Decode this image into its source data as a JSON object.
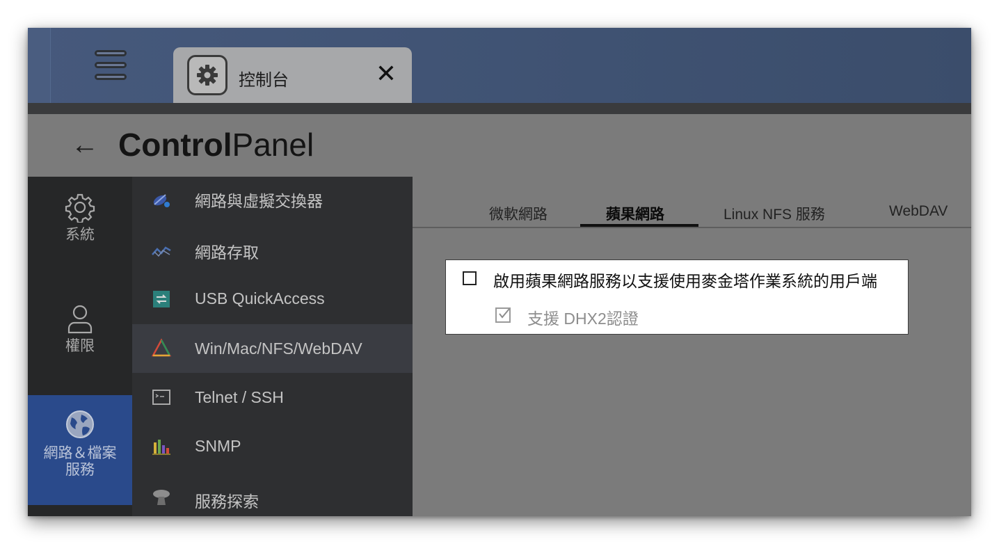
{
  "window": {
    "tab_title": "控制台",
    "tab_close": "✕"
  },
  "header": {
    "back": "←",
    "title_bold": "Control",
    "title_light": "Panel"
  },
  "rail": {
    "items": [
      {
        "label": "系統",
        "icon": "gear-outline-icon"
      },
      {
        "label": "權限",
        "icon": "user-outline-icon"
      },
      {
        "label_line1": "網路＆檔案",
        "label_line2": "服務",
        "icon": "globe-icon",
        "active": true
      }
    ]
  },
  "submenu": {
    "items": [
      {
        "label": "網路與虛擬交換器",
        "icon": "network-switch-icon"
      },
      {
        "label": "網路存取",
        "icon": "network-access-icon"
      },
      {
        "label": "USB QuickAccess",
        "icon": "usb-quickaccess-icon"
      },
      {
        "label": "Win/Mac/NFS/WebDAV",
        "icon": "win-mac-nfs-icon",
        "active": true
      },
      {
        "label": "Telnet / SSH",
        "icon": "terminal-icon"
      },
      {
        "label": "SNMP",
        "icon": "bar-chart-icon"
      },
      {
        "label": "服務探索",
        "icon": "satellite-dish-icon"
      }
    ]
  },
  "content": {
    "tabs": [
      "微軟網路",
      "蘋果網路",
      "Linux NFS 服務",
      "WebDAV"
    ],
    "active_tab": "蘋果網路",
    "options": {
      "enable_afp_label": "啟用蘋果網路服務以支援使用麥金塔作業系統的用戶端",
      "enable_afp_checked": false,
      "dhx2_label": "支援 DHX2認證",
      "dhx2_checked": true,
      "dhx2_disabled": true
    }
  },
  "colors": {
    "topbar": "#46597c",
    "rail_active": "#2a4a8b",
    "overlay_gray": "#7b7b7b"
  }
}
